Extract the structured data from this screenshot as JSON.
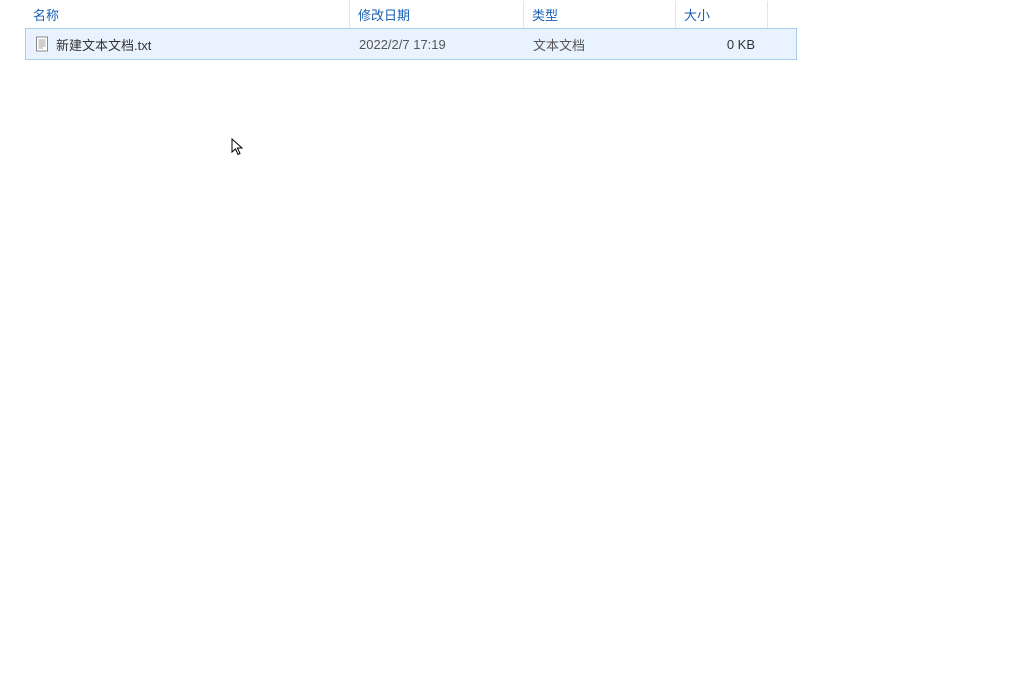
{
  "columns": {
    "name": "名称",
    "date": "修改日期",
    "type": "类型",
    "size": "大小"
  },
  "files": [
    {
      "name": "新建文本文档.txt",
      "date": "2022/2/7 17:19",
      "type": "文本文档",
      "size": "0 KB",
      "icon": "text-file-icon"
    }
  ]
}
